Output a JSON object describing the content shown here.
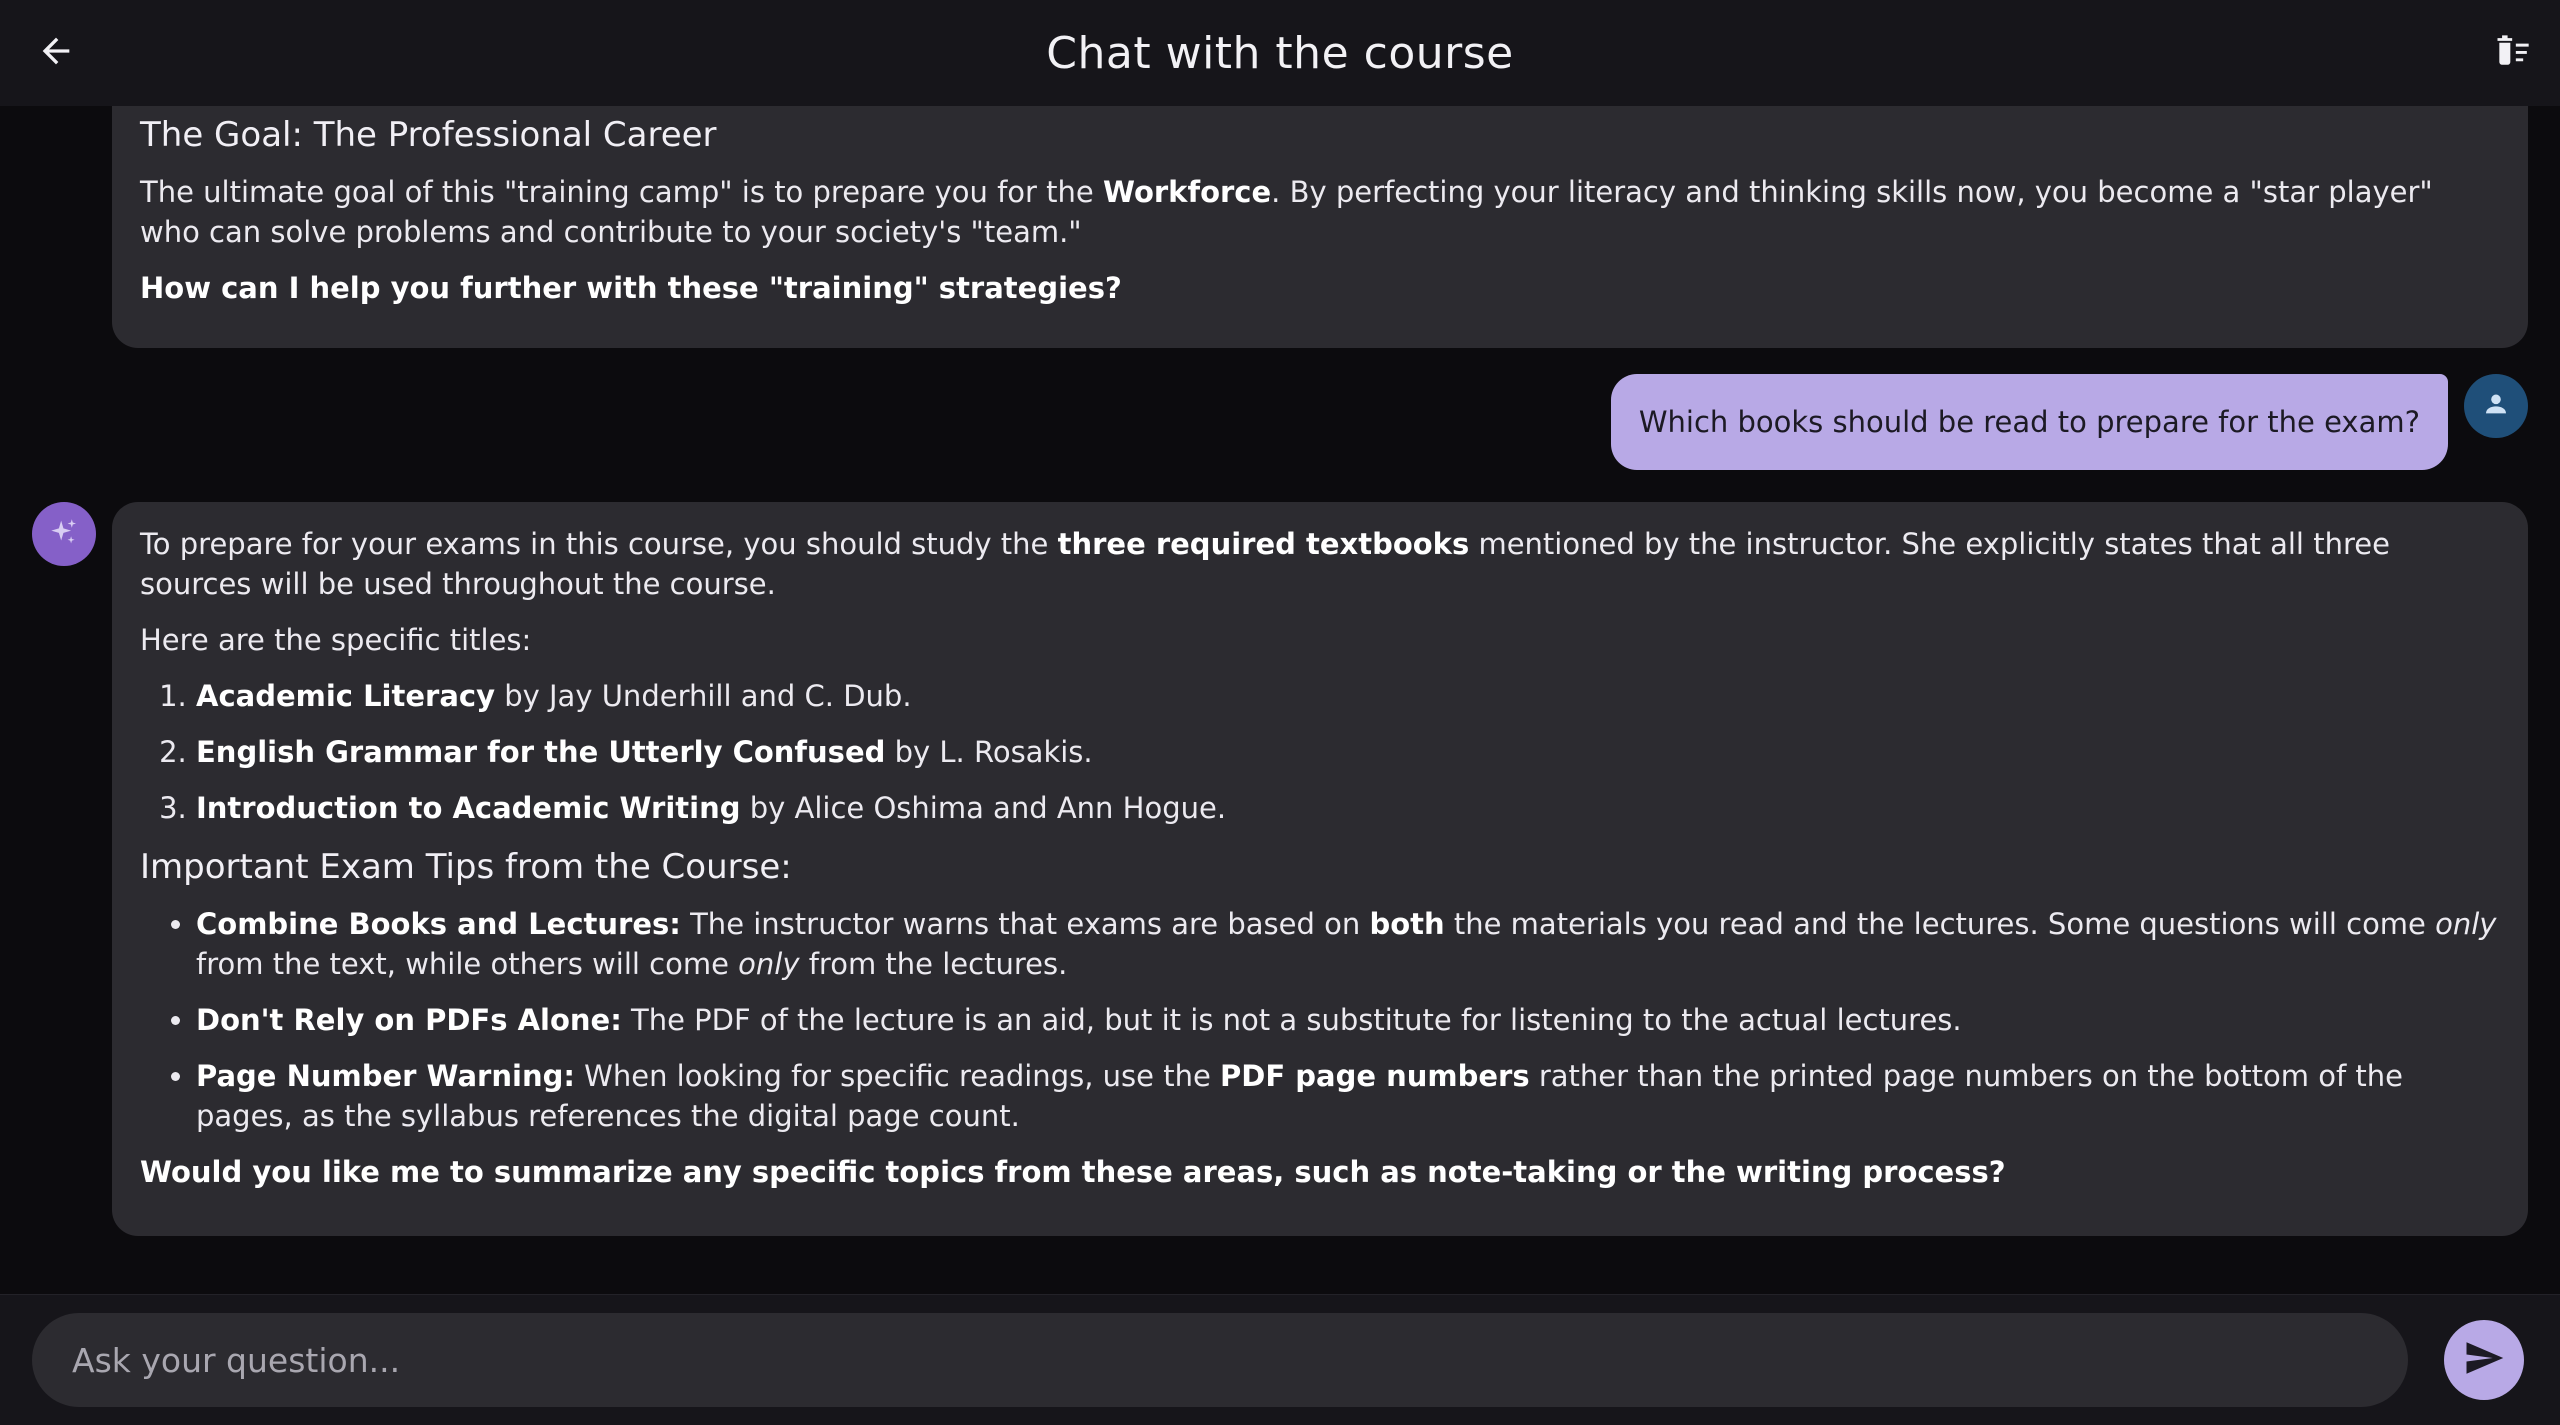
{
  "header": {
    "title": "Chat with the course",
    "back_icon": "arrow-back-icon",
    "delete_icon": "delete-sweep-icon"
  },
  "messages": {
    "ai_1": {
      "heading": "The Goal: The Professional Career",
      "p1_a": "The ultimate goal of this \"training camp\" is to prepare you for the ",
      "p1_b": "Workforce",
      "p1_c": ". By perfecting your literacy and thinking skills now, you become a \"star player\" who can solve problems and contribute to your society's \"team.\"",
      "closing": "How can I help you further with these \"training\" strategies?"
    },
    "user_1": {
      "text": "Which books should be read to prepare for the exam?",
      "avatar_icon": "person-icon"
    },
    "ai_2": {
      "avatar_icon": "sparkle-icon",
      "intro_a": "To prepare for your exams in this course, you should study the ",
      "intro_b": "three required textbooks",
      "intro_c": " mentioned by the instructor. She explicitly states that all three sources will be used throughout the course.",
      "titles_label": "Here are the specific titles:",
      "books": [
        {
          "title": "Academic Literacy",
          "author": " by Jay Underhill and C. Dub."
        },
        {
          "title": "English Grammar for the Utterly Confused",
          "author": " by L. Rosakis."
        },
        {
          "title": "Introduction to Academic Writing",
          "author": " by Alice Oshima and Ann Hogue."
        }
      ],
      "tips_heading": "Important Exam Tips from the Course:",
      "tip1": {
        "label": "Combine Books and Lectures:",
        "a": " The instructor warns that exams are based on ",
        "b": "both",
        "c": " the materials you read and the lectures. Some questions will come ",
        "d": "only",
        "e": " from the text, while others will come ",
        "f": "only",
        "g": " from the lectures."
      },
      "tip2": {
        "label": "Don't Rely on PDFs Alone:",
        "a": " The PDF of the lecture is an aid, but it is not a substitute for listening to the actual lectures."
      },
      "tip3": {
        "label": "Page Number Warning:",
        "a": " When looking for specific readings, use the ",
        "b": "PDF page numbers",
        "c": " rather than the printed page numbers on the bottom of the pages, as the syllabus references the digital page count."
      },
      "closing": "Would you like me to summarize any specific topics from these areas, such as note-taking or the writing process?"
    }
  },
  "composer": {
    "placeholder": "Ask your question...",
    "send_icon": "send-icon"
  },
  "colors": {
    "background": "#0c0b0e",
    "bar": "#16151a",
    "ai_bubble": "#2c2b30",
    "user_bubble": "#b8a9e6",
    "user_avatar": "#1f4f79",
    "ai_avatar": "#8560c8"
  }
}
